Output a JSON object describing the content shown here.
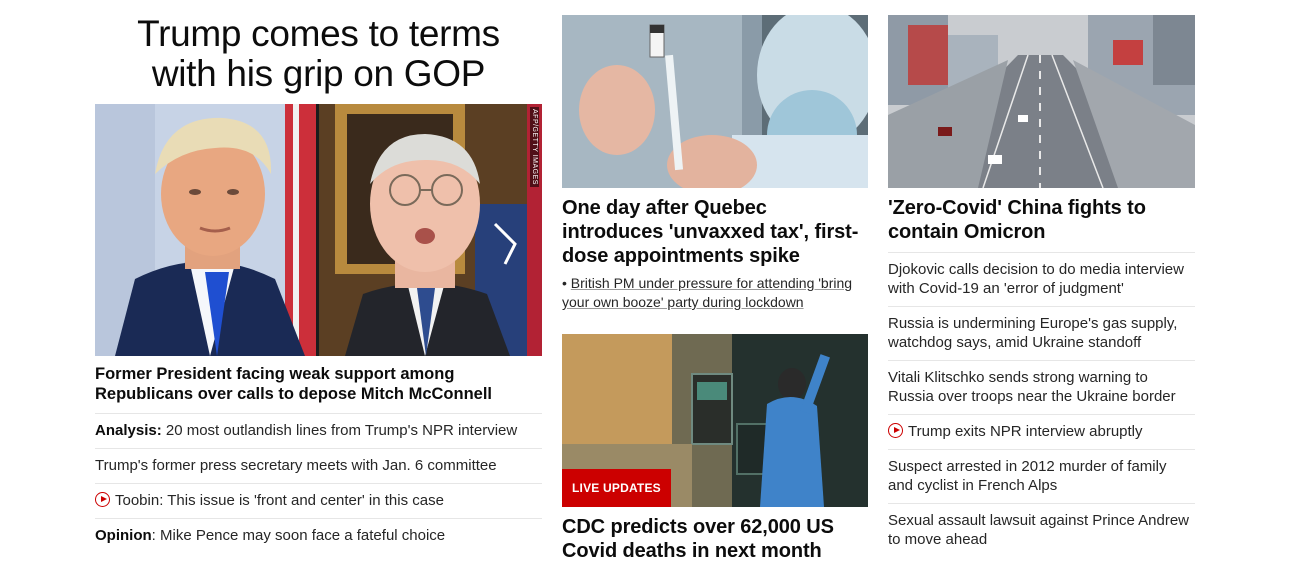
{
  "lead": {
    "title_line1": "Trump comes to terms",
    "title_line2": "with his grip on GOP",
    "image_credit": "AFP/GETTY IMAGES",
    "headline": "Former President facing weak support among Republicans over calls to depose Mitch McConnell",
    "items": [
      {
        "prefix": "Analysis:",
        "text": " 20 most outlandish lines from Trump's NPR interview"
      },
      {
        "text": "Trump's former press secretary meets with Jan. 6 committee"
      },
      {
        "text": "Toobin: This issue is 'front and center' in this case",
        "icon": "play-icon"
      },
      {
        "prefix": "Opinion",
        "text": ": Mike Pence may soon face a fateful choice"
      }
    ]
  },
  "middle": {
    "story1": {
      "headline": "One day after Quebec introduces 'unvaxxed tax', first-dose appointments spike",
      "bullet": "British PM under pressure for attending 'bring your own booze' party during lockdown"
    },
    "story2": {
      "badge": "LIVE UPDATES",
      "headline": "CDC predicts over 62,000 US Covid deaths in next month"
    }
  },
  "right": {
    "headline": "'Zero-Covid' China fights to contain Omicron",
    "items": [
      {
        "text": "Djokovic calls decision to do media interview with Covid-19 an 'error of judgment'"
      },
      {
        "text": "Russia is undermining Europe's gas supply, watchdog says, amid Ukraine standoff"
      },
      {
        "text": "Vitali Klitschko sends strong warning to Russia over troops near the Ukraine border"
      },
      {
        "text": "Trump exits NPR interview abruptly",
        "icon": "play-icon"
      },
      {
        "text": "Suspect arrested in 2012 murder of family and cyclist in French Alps"
      },
      {
        "text": "Sexual assault lawsuit against Prince Andrew to move ahead"
      }
    ]
  },
  "colors": {
    "accent_red": "#cc0000",
    "text": "#0c0c0c",
    "divider": "#e6e6e6"
  }
}
